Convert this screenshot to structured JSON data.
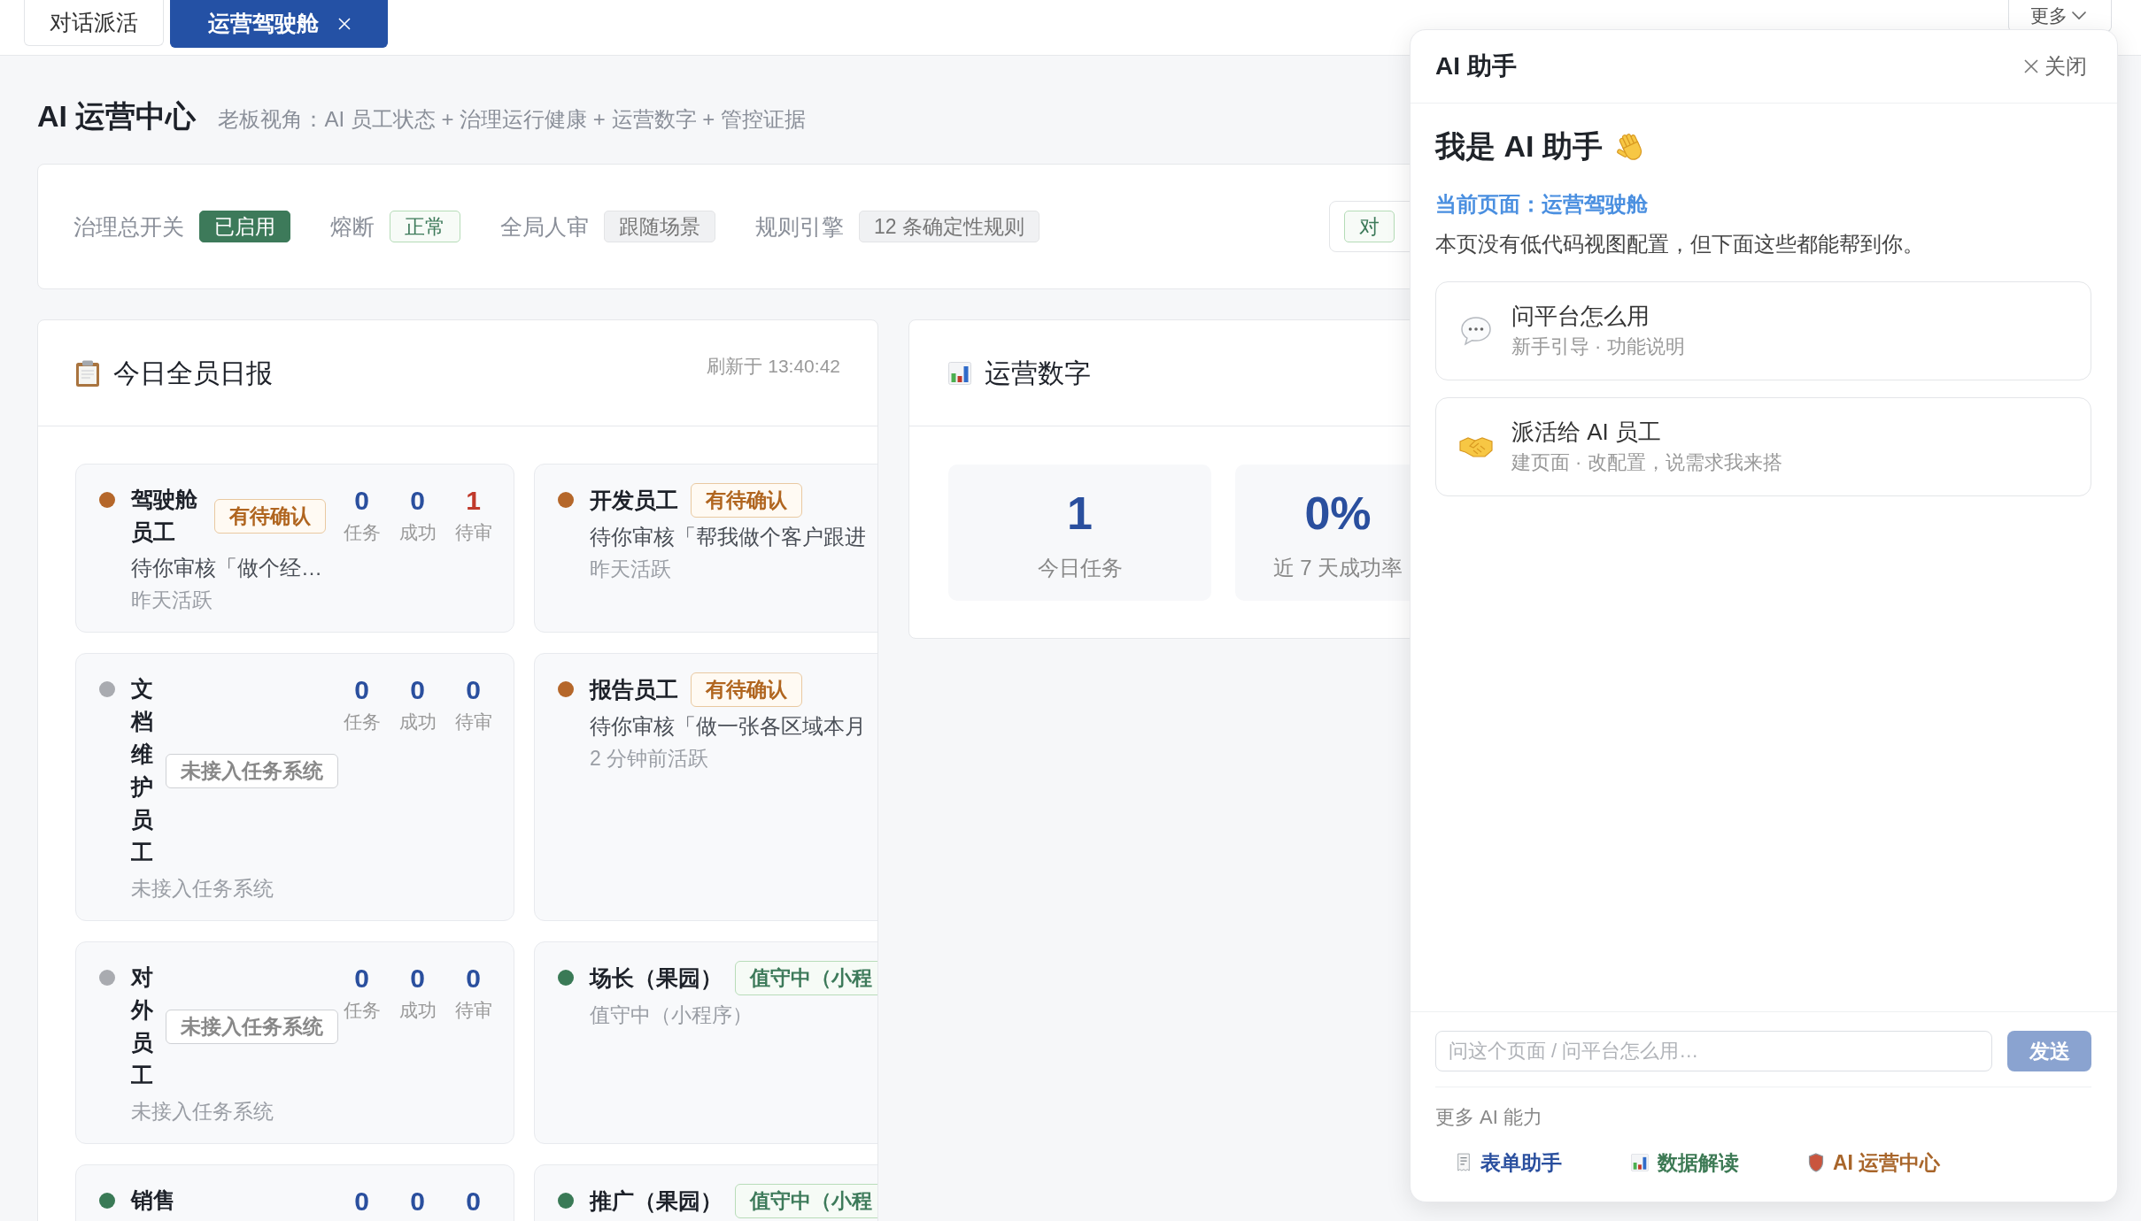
{
  "tabs": [
    {
      "label": "对话派活",
      "selected": false,
      "closable": false
    },
    {
      "label": "运营驾驶舱",
      "selected": true,
      "closable": true
    }
  ],
  "more_button": {
    "label": "更多"
  },
  "page": {
    "title": "AI 运营中心",
    "subtitle": "老板视角：AI 员工状态 + 治理运行健康 + 运营数字 + 管控证据"
  },
  "governance": {
    "settings": [
      {
        "label": "治理总开关",
        "badge": {
          "text": "已启用",
          "kind": "solid"
        }
      },
      {
        "label": "熔断",
        "badge": {
          "text": "正常",
          "kind": "outline"
        }
      },
      {
        "label": "全局人审",
        "badge": {
          "text": "跟随场景",
          "kind": "neutral"
        }
      },
      {
        "label": "规则引擎",
        "badge": {
          "text": "12 条确定性规则",
          "kind": "neutral"
        }
      }
    ],
    "side_box": {
      "badges": [
        {
          "text": "对",
          "kind": "outline"
        }
      ]
    }
  },
  "daily_report": {
    "title": "今日全员日报",
    "refreshed": "刷新于 13:40:42",
    "employees": [
      {
        "name": "驾驶舱员工",
        "color": "#b5672a",
        "badge": {
          "text": "有待确认",
          "kind": "pending"
        },
        "stats": [
          {
            "value": "0",
            "label": "任务",
            "alert": false
          },
          {
            "value": "0",
            "label": "成功",
            "alert": false
          },
          {
            "value": "1",
            "label": "待审",
            "alert": true
          }
        ],
        "desc": "待你审核「做个经…",
        "activity": "昨天活跃"
      },
      {
        "name": "开发员工",
        "color": "#b5672a",
        "badge": {
          "text": "有待确认",
          "kind": "pending"
        },
        "desc": "待你审核「帮我做个客户跟进",
        "activity": "昨天活跃"
      },
      {
        "name": "文档维护员工",
        "color": "#a9abb0",
        "badge": {
          "text": "未接入任务系统",
          "kind": "offline"
        },
        "stats": [
          {
            "value": "0",
            "label": "任务",
            "alert": false
          },
          {
            "value": "0",
            "label": "成功",
            "alert": false
          },
          {
            "value": "0",
            "label": "待审",
            "alert": false
          }
        ],
        "activity": "未接入任务系统"
      },
      {
        "name": "报告员工",
        "color": "#b5672a",
        "badge": {
          "text": "有待确认",
          "kind": "pending"
        },
        "desc": "待你审核「做一张各区域本月",
        "activity": "2 分钟前活跃"
      },
      {
        "name": "对外员工",
        "color": "#a9abb0",
        "badge": {
          "text": "未接入任务系统",
          "kind": "offline"
        },
        "stats": [
          {
            "value": "0",
            "label": "任务",
            "alert": false
          },
          {
            "value": "0",
            "label": "成功",
            "alert": false
          },
          {
            "value": "0",
            "label": "待审",
            "alert": false
          }
        ],
        "activity": "未接入任务系统"
      },
      {
        "name": "场长（果园）",
        "color": "#3a7a56",
        "badge": {
          "text": "值守中（小程",
          "kind": "on_duty"
        },
        "activity": "值守中（小程序）"
      },
      {
        "name": "销售",
        "color": "#3a7a56",
        "stats": [
          {
            "value": "0",
            "alert": false
          },
          {
            "value": "0",
            "alert": false
          },
          {
            "value": "0",
            "alert": false
          }
        ]
      },
      {
        "name": "推广（果园）",
        "color": "#3a7a56",
        "badge": {
          "text": "值守中（小程",
          "kind": "on_duty"
        }
      }
    ]
  },
  "metrics": {
    "title": "运营数字",
    "tiles": [
      {
        "value": "1",
        "label": "今日任务"
      },
      {
        "value": "0%",
        "label": "近 7 天成功率"
      }
    ]
  },
  "assistant": {
    "title": "AI 助手",
    "close": "关闭",
    "greeting": "我是 AI 助手",
    "current_page": "当前页面：运营驾驶舱",
    "note": "本页没有低代码视图配置，但下面这些都能帮到你。",
    "options": [
      {
        "kind": "ask",
        "title": "问平台怎么用",
        "subtitle": "新手引导 · 功能说明"
      },
      {
        "kind": "dispatch",
        "title": "派活给 AI 员工",
        "subtitle": "建页面 · 改配置，说需求我来搭"
      }
    ],
    "input": {
      "placeholder": "问这个页面 / 问平台怎么用…"
    },
    "send": {
      "label": "发送",
      "disabled": true
    },
    "more_label": "更多 AI 能力",
    "links": [
      {
        "kind": "form",
        "label": "表单助手",
        "color": "#2a4f9e"
      },
      {
        "kind": "data",
        "label": "数据解读",
        "color": "#3d7a55"
      },
      {
        "kind": "ops",
        "label": "AI 运营中心",
        "color": "#a8652a"
      }
    ]
  }
}
